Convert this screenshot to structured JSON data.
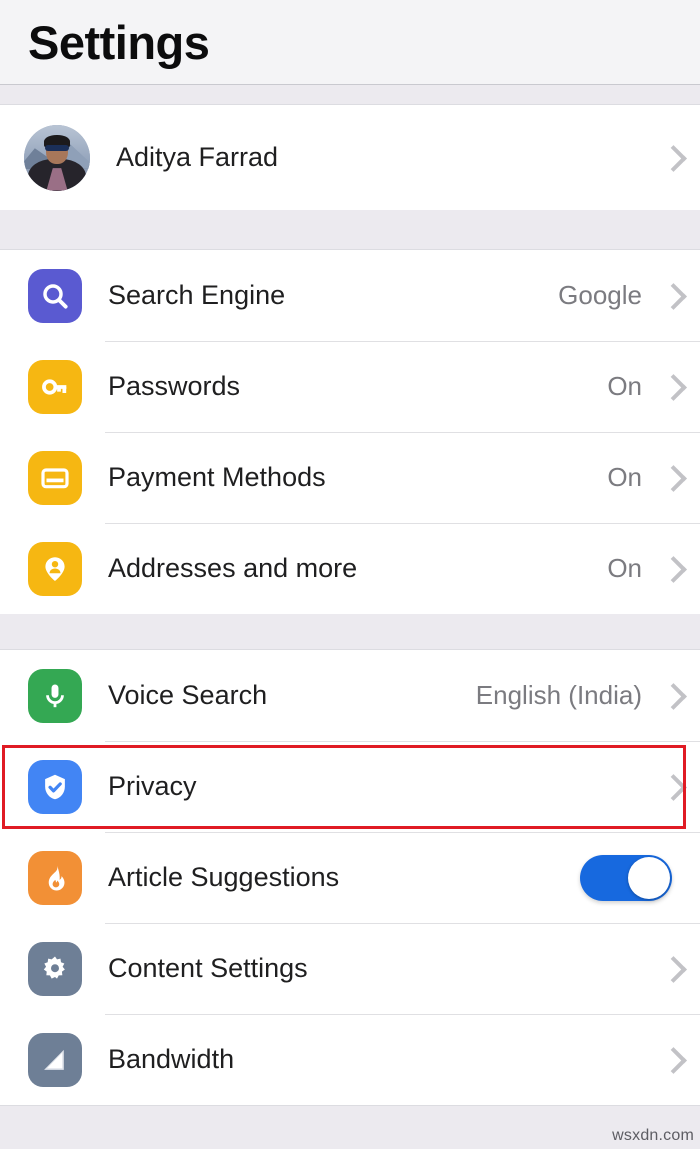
{
  "header": {
    "title": "Settings"
  },
  "account": {
    "name": "Aditya Farrad",
    "avatar_icon": "profile-photo",
    "chevron_icon": "chevron-right-icon"
  },
  "groups": [
    {
      "id": "browsing-data",
      "rows": [
        {
          "label": "Search Engine",
          "value": "Google",
          "icon": "magnifier-icon",
          "icon_color": "#5a5ad1",
          "accessory": "chevron"
        },
        {
          "label": "Passwords",
          "value": "On",
          "icon": "key-icon",
          "icon_color": "#f6b712",
          "accessory": "chevron"
        },
        {
          "label": "Payment Methods",
          "value": "On",
          "icon": "credit-card-icon",
          "icon_color": "#f6b712",
          "accessory": "chevron"
        },
        {
          "label": "Addresses and more",
          "value": "On",
          "icon": "address-pin-person-icon",
          "icon_color": "#f6b712",
          "accessory": "chevron"
        }
      ]
    },
    {
      "id": "features",
      "rows": [
        {
          "label": "Voice Search",
          "value": "English (India)",
          "icon": "microphone-icon",
          "icon_color": "#34a853",
          "accessory": "chevron"
        },
        {
          "label": "Privacy",
          "value": "",
          "icon": "shield-check-icon",
          "icon_color": "#4285f4",
          "accessory": "chevron",
          "highlighted": true
        },
        {
          "label": "Article Suggestions",
          "value": "",
          "icon": "flame-icon",
          "icon_color": "#f29036",
          "accessory": "toggle",
          "toggle_on": true
        },
        {
          "label": "Content Settings",
          "value": "",
          "icon": "gear-icon",
          "icon_color": "#6e7f96",
          "accessory": "chevron"
        },
        {
          "label": "Bandwidth",
          "value": "",
          "icon": "signal-bars-icon",
          "icon_color": "#6e7f96",
          "accessory": "chevron"
        }
      ]
    }
  ],
  "highlight": {
    "target": "Privacy",
    "color": "#e01b24"
  },
  "watermark": {
    "text": "wsxdn.com"
  },
  "colors": {
    "page_background": "#ffffff",
    "header_background": "#f4f4f6",
    "group_gap": "#eceaef",
    "label_text": "#1f1f20",
    "value_text": "#7b7b80",
    "divider": "#e0e0e3",
    "toggle_on": "#1769df",
    "chevron": "#c2c2c6"
  }
}
